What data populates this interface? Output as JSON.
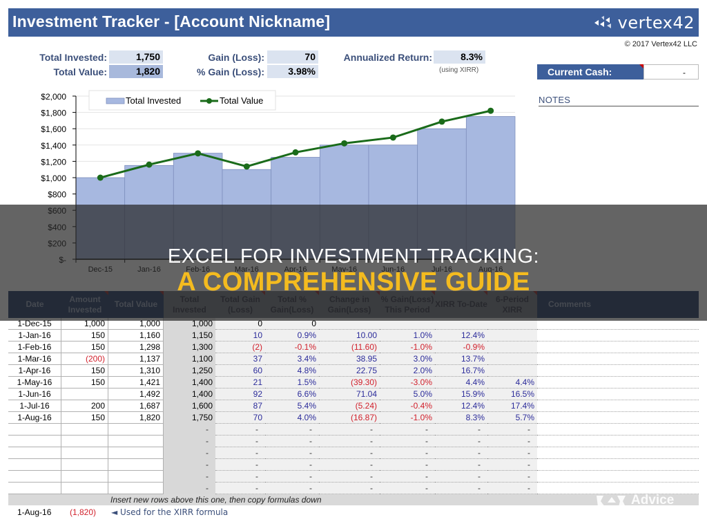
{
  "header": {
    "title": "Investment Tracker - [Account Nickname]",
    "logo_text": "vertex42",
    "copyright": "© 2017 Vertex42 LLC"
  },
  "summary": {
    "total_invested_label": "Total Invested:",
    "total_invested": "1,750",
    "total_value_label": "Total Value:",
    "total_value": "1,820",
    "gain_label": "Gain (Loss):",
    "gain": "70",
    "pct_gain_label": "% Gain (Loss):",
    "pct_gain": "3.98%",
    "annualized_label": "Annualized Return:",
    "annualized": "8.3%",
    "annualized_note": "(using XIRR)"
  },
  "cash": {
    "label": "Current Cash:",
    "value": "-"
  },
  "notes_label": "NOTES",
  "chart_data": {
    "type": "bar+line",
    "title": "",
    "categories": [
      "Dec-15",
      "Jan-16",
      "Feb-16",
      "Mar-16",
      "Apr-16",
      "May-16",
      "Jun-16",
      "Jul-16",
      "Aug-16"
    ],
    "series": [
      {
        "name": "Total Invested",
        "type": "bar",
        "color": "#a7b8e0",
        "values": [
          1000,
          1150,
          1300,
          1100,
          1250,
          1400,
          1400,
          1600,
          1750
        ]
      },
      {
        "name": "Total Value",
        "type": "line",
        "color": "#1a6b1a",
        "values": [
          1000,
          1160,
          1298,
          1137,
          1310,
          1421,
          1492,
          1687,
          1820
        ]
      }
    ],
    "ylim": [
      0,
      2000
    ],
    "yticks": [
      0,
      200,
      400,
      600,
      800,
      1000,
      1200,
      1400,
      1600,
      1800,
      2000
    ],
    "ytick_labels": [
      "$-",
      "$200",
      "$400",
      "$600",
      "$800",
      "$1,000",
      "$1,200",
      "$1,400",
      "$1,600",
      "$1,800",
      "$2,000"
    ],
    "xlabel": "",
    "ylabel": "",
    "grid": true,
    "legend": "top-left"
  },
  "table": {
    "headers": [
      "Date",
      "Amount Invested",
      "Total Value",
      "Total Invested",
      "Total Gain (Loss)",
      "Total % Gain(Loss)",
      "Change in Gain(Loss)",
      "% Gain(Loss) This Period",
      "XIRR To-Date",
      "6-Period XIRR",
      "Comments"
    ],
    "rows": [
      [
        "1-Dec-15",
        "1,000",
        "1,000",
        "1,000",
        "0",
        "0",
        "",
        "",
        "",
        "",
        ""
      ],
      [
        "1-Jan-16",
        "150",
        "1,160",
        "1,150",
        "10",
        "0.9%",
        "10.00",
        "1.0%",
        "12.4%",
        "",
        ""
      ],
      [
        "1-Feb-16",
        "150",
        "1,298",
        "1,300",
        "(2)",
        "-0.1%",
        "(11.60)",
        "-1.0%",
        "-0.9%",
        "",
        ""
      ],
      [
        "1-Mar-16",
        "(200)",
        "1,137",
        "1,100",
        "37",
        "3.4%",
        "38.95",
        "3.0%",
        "13.7%",
        "",
        ""
      ],
      [
        "1-Apr-16",
        "150",
        "1,310",
        "1,250",
        "60",
        "4.8%",
        "22.75",
        "2.0%",
        "16.7%",
        "",
        ""
      ],
      [
        "1-May-16",
        "150",
        "1,421",
        "1,400",
        "21",
        "1.5%",
        "(39.30)",
        "-3.0%",
        "4.4%",
        "4.4%",
        ""
      ],
      [
        "1-Jun-16",
        "",
        "1,492",
        "1,400",
        "92",
        "6.6%",
        "71.04",
        "5.0%",
        "15.9%",
        "16.5%",
        ""
      ],
      [
        "1-Jul-16",
        "200",
        "1,687",
        "1,600",
        "87",
        "5.4%",
        "(5.24)",
        "-0.4%",
        "12.4%",
        "17.4%",
        ""
      ],
      [
        "1-Aug-16",
        "150",
        "1,820",
        "1,750",
        "70",
        "4.0%",
        "(16.87)",
        "-1.0%",
        "8.3%",
        "5.7%",
        ""
      ],
      [
        "",
        "",
        "",
        "-",
        "-",
        "-",
        "-",
        "-",
        "-",
        "-",
        ""
      ],
      [
        "",
        "",
        "",
        "-",
        "-",
        "-",
        "-",
        "-",
        "-",
        "-",
        ""
      ],
      [
        "",
        "",
        "",
        "-",
        "-",
        "-",
        "-",
        "-",
        "-",
        "-",
        ""
      ],
      [
        "",
        "",
        "",
        "-",
        "-",
        "-",
        "-",
        "-",
        "-",
        "-",
        ""
      ],
      [
        "",
        "",
        "",
        "-",
        "-",
        "-",
        "-",
        "-",
        "-",
        "-",
        ""
      ],
      [
        "",
        "",
        "",
        "-",
        "-",
        "-",
        "-",
        "-",
        "-",
        "-",
        ""
      ]
    ],
    "footer_note": "Insert new rows above this one, then copy formulas down"
  },
  "xirr_row": {
    "date": "1-Aug-16",
    "value": "(1,820)",
    "note": "◄ Used for the XIRR formula"
  },
  "watermark": "Advice",
  "banner": {
    "line1": "EXCEL FOR INVESTMENT TRACKING:",
    "line2": "A COMPREHENSIVE GUIDE"
  }
}
